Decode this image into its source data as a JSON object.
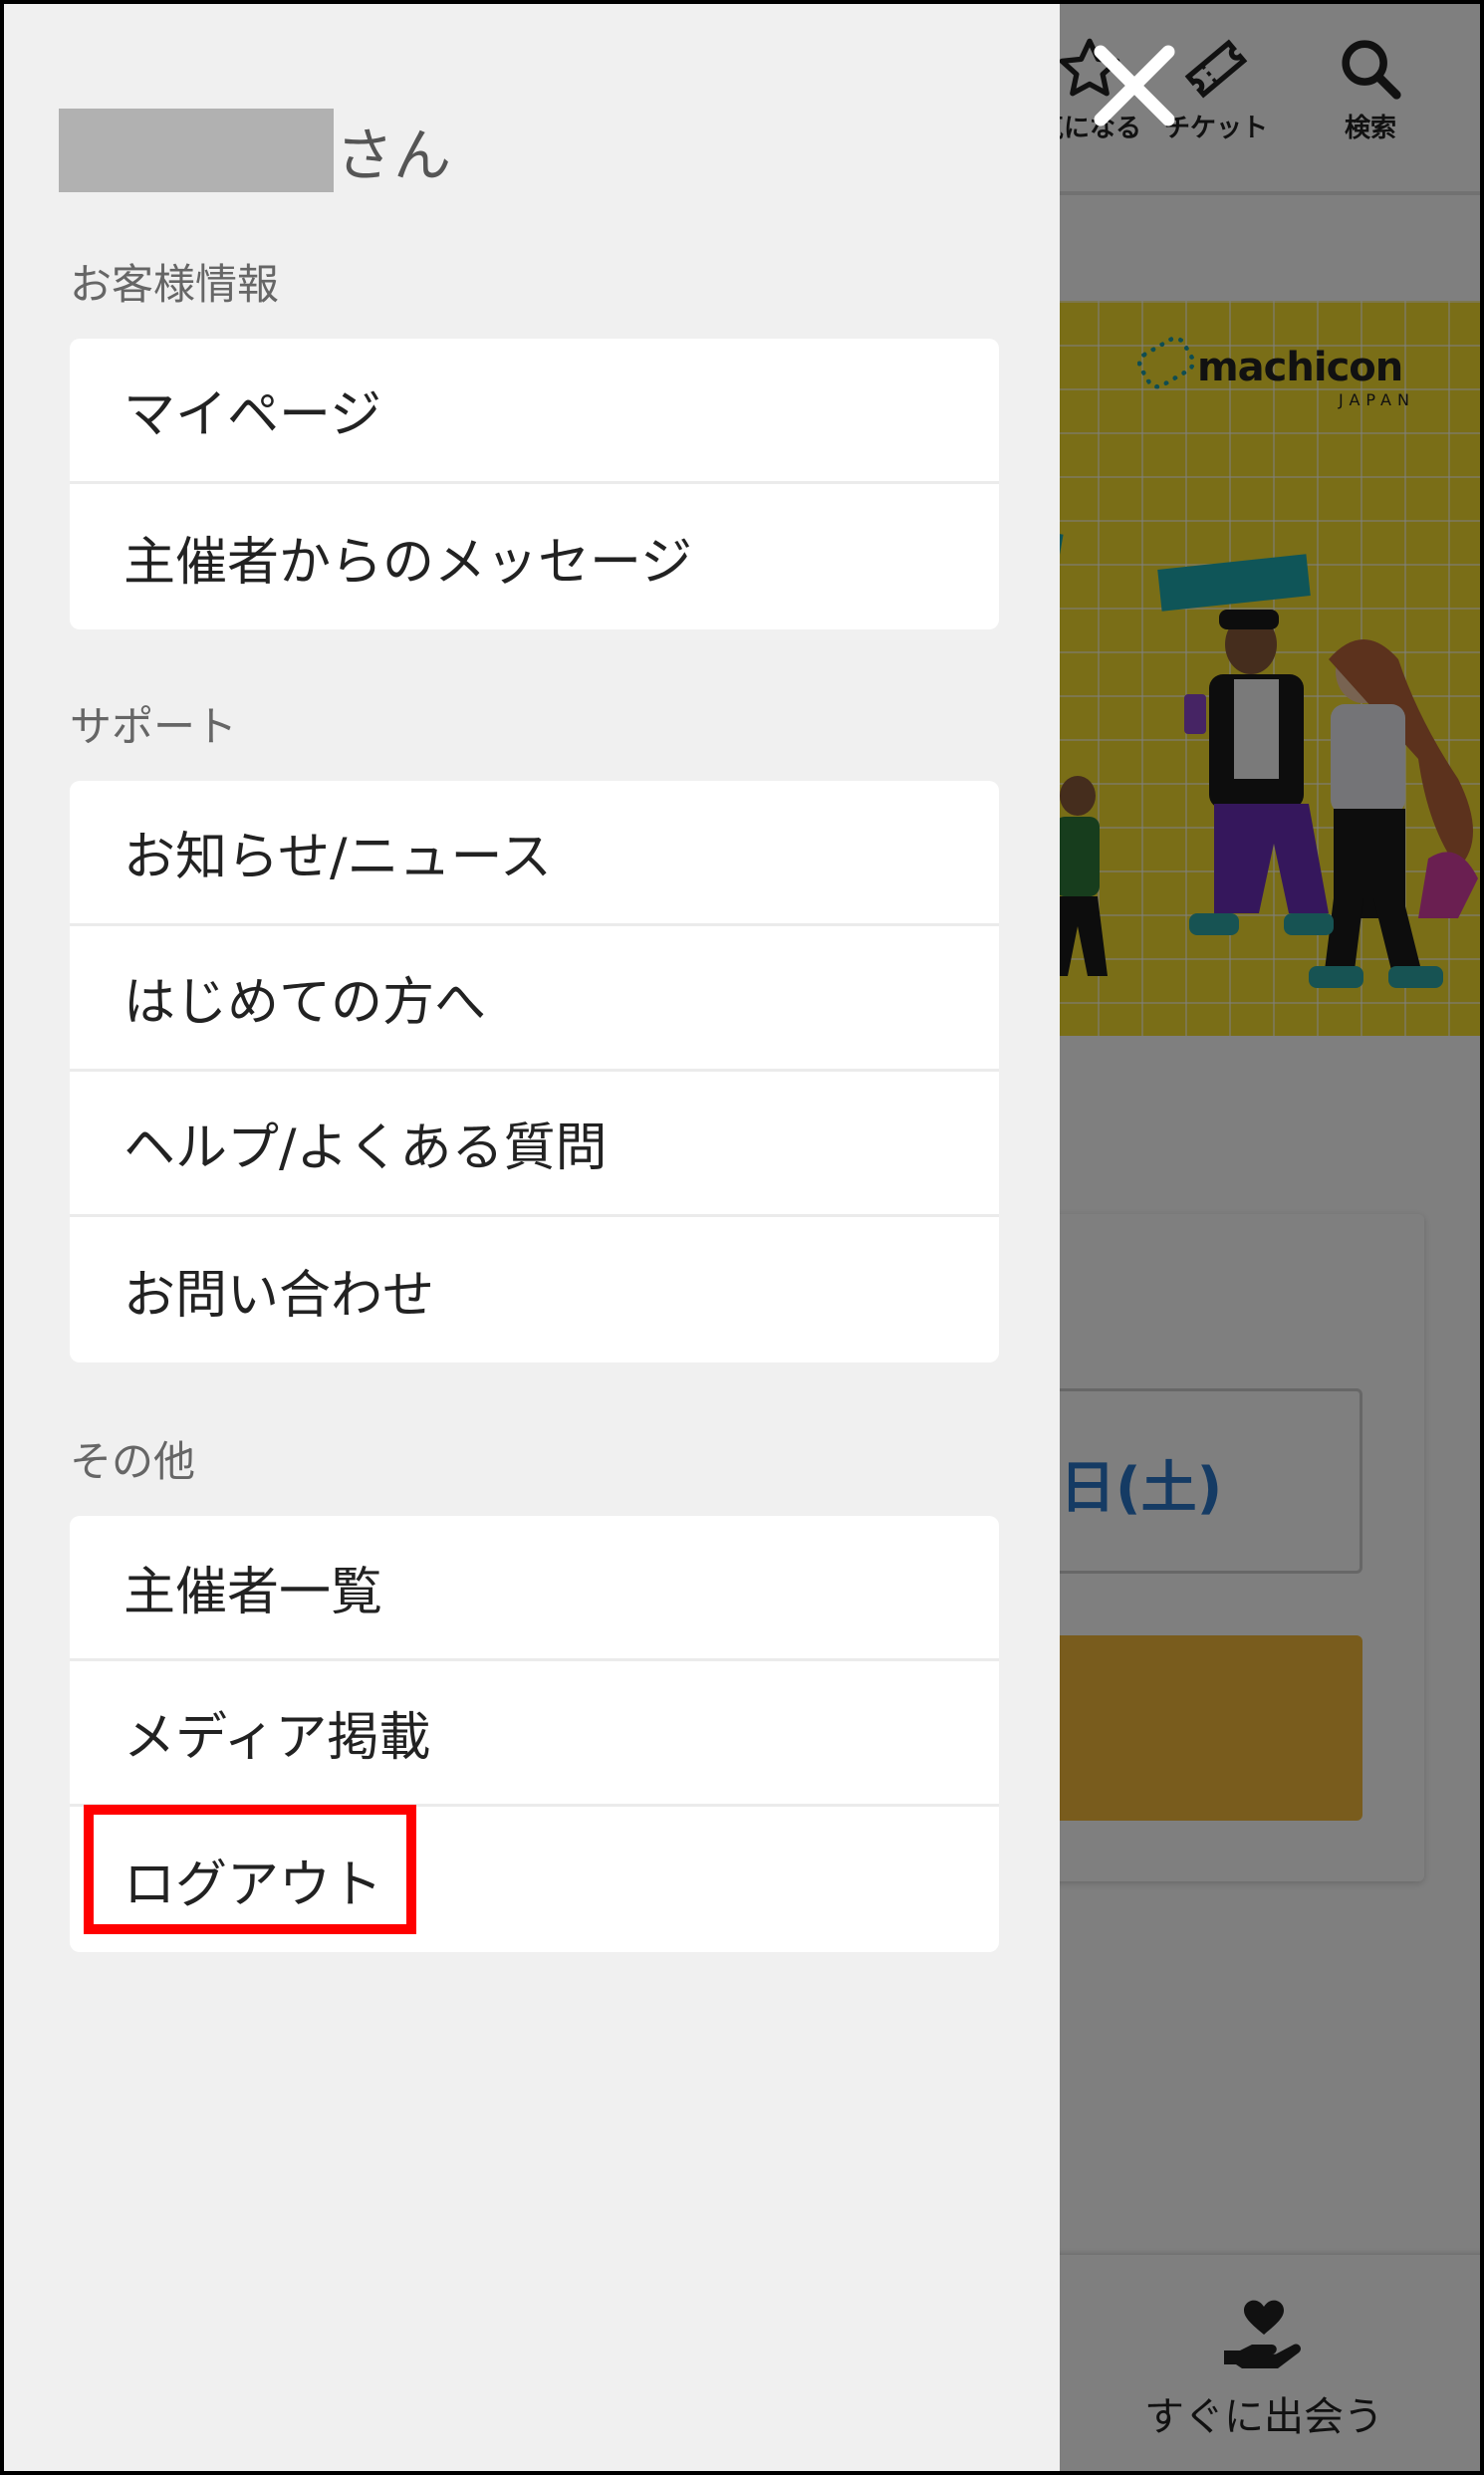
{
  "header": {
    "favorite_label": "気になる",
    "ticket_label": "チケット",
    "search_label": "検索"
  },
  "banner": {
    "logo_text": "machicon",
    "logo_sub": "JAPAN"
  },
  "event_card": {
    "date_text": "日(土)"
  },
  "tabbar": {
    "meet_label": "すぐに出会う"
  },
  "drawer": {
    "user_suffix": "さん",
    "sections": [
      {
        "title": "お客様情報",
        "items": [
          "マイページ",
          "主催者からのメッセージ"
        ]
      },
      {
        "title": "サポート",
        "items": [
          "お知らせ/ニュース",
          "はじめての方へ",
          "ヘルプ/よくある質問",
          "お問い合わせ"
        ]
      },
      {
        "title": "その他",
        "items": [
          "主催者一覧",
          "メディア掲載",
          "ログアウト"
        ]
      }
    ]
  },
  "colors": {
    "highlight": "#ff0000",
    "drawer_bg": "#f0f0f0",
    "banner_bg": "#f4dd2e",
    "date_text": "#2b77c9",
    "cta": "#f2b93a"
  }
}
